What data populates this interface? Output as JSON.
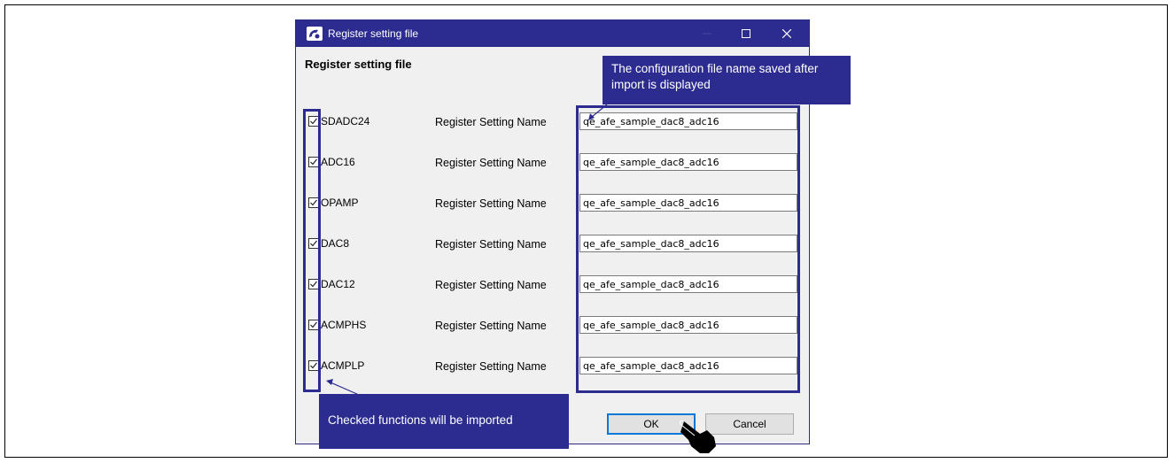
{
  "window": {
    "title": "Register setting file",
    "header": "Register setting file"
  },
  "rows": [
    {
      "name": "SDADC24",
      "label": "Register Setting Name",
      "value": "qe_afe_sample_dac8_adc16",
      "checked": true
    },
    {
      "name": "ADC16",
      "label": "Register Setting Name",
      "value": "qe_afe_sample_dac8_adc16",
      "checked": true
    },
    {
      "name": "OPAMP",
      "label": "Register Setting Name",
      "value": "qe_afe_sample_dac8_adc16",
      "checked": true
    },
    {
      "name": "DAC8",
      "label": "Register Setting Name",
      "value": "qe_afe_sample_dac8_adc16",
      "checked": true
    },
    {
      "name": "DAC12",
      "label": "Register Setting Name",
      "value": "qe_afe_sample_dac8_adc16",
      "checked": true
    },
    {
      "name": "ACMPHS",
      "label": "Register Setting Name",
      "value": "qe_afe_sample_dac8_adc16",
      "checked": true
    },
    {
      "name": "ACMPLP",
      "label": "Register Setting Name",
      "value": "qe_afe_sample_dac8_adc16",
      "checked": true
    }
  ],
  "buttons": {
    "ok": "OK",
    "cancel": "Cancel"
  },
  "callouts": {
    "top": "The configuration file name saved after import is displayed",
    "bottom": "Checked functions will be imported"
  },
  "colors": {
    "accent": "#2c2c90",
    "ok_border": "#0078d7"
  },
  "icons": {
    "app": "app-logo-icon",
    "minimize": "minimize-icon",
    "maximize": "maximize-icon",
    "close": "close-icon",
    "cursor": "hand-pointer-icon"
  }
}
